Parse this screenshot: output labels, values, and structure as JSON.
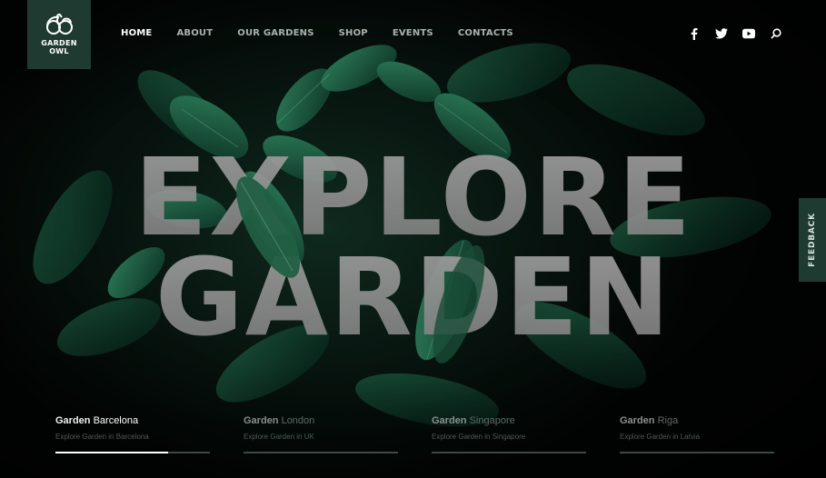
{
  "brand": {
    "line1": "GARDEN",
    "line2": "OWL",
    "bg_color": "#1f3a31"
  },
  "nav": {
    "items": [
      {
        "label": "HOME",
        "active": true
      },
      {
        "label": "ABOUT",
        "active": false
      },
      {
        "label": "OUR GARDENS",
        "active": false
      },
      {
        "label": "SHOP",
        "active": false
      },
      {
        "label": "EVENTS",
        "active": false
      },
      {
        "label": "CONTACTS",
        "active": false
      }
    ]
  },
  "social": {
    "icons": [
      "facebook-icon",
      "twitter-icon",
      "youtube-icon",
      "search-icon"
    ]
  },
  "hero": {
    "line1": "EXPLORE",
    "line2": "GARDEN",
    "text_color": "#8f8f8f"
  },
  "feedback": {
    "label": "FEEDBACK"
  },
  "slides": [
    {
      "strong": "Garden",
      "light": " Barcelona",
      "sub": "Explore Garden in Barcelona",
      "active": true,
      "progress": 0.73
    },
    {
      "strong": "Garden",
      "light": " London",
      "sub": "Explore Garden in UK",
      "active": false,
      "progress": 0
    },
    {
      "strong": "Garden",
      "light": " Singapore",
      "sub": "Explore Garden in Singapore",
      "active": false,
      "progress": 0
    },
    {
      "strong": "Garden",
      "light": " Riga",
      "sub": "Explore Garden in Latvia",
      "active": false,
      "progress": 0
    }
  ],
  "colors": {
    "accent": "#1f3a31",
    "leaf": "#1e5a40",
    "background": "#050807"
  }
}
